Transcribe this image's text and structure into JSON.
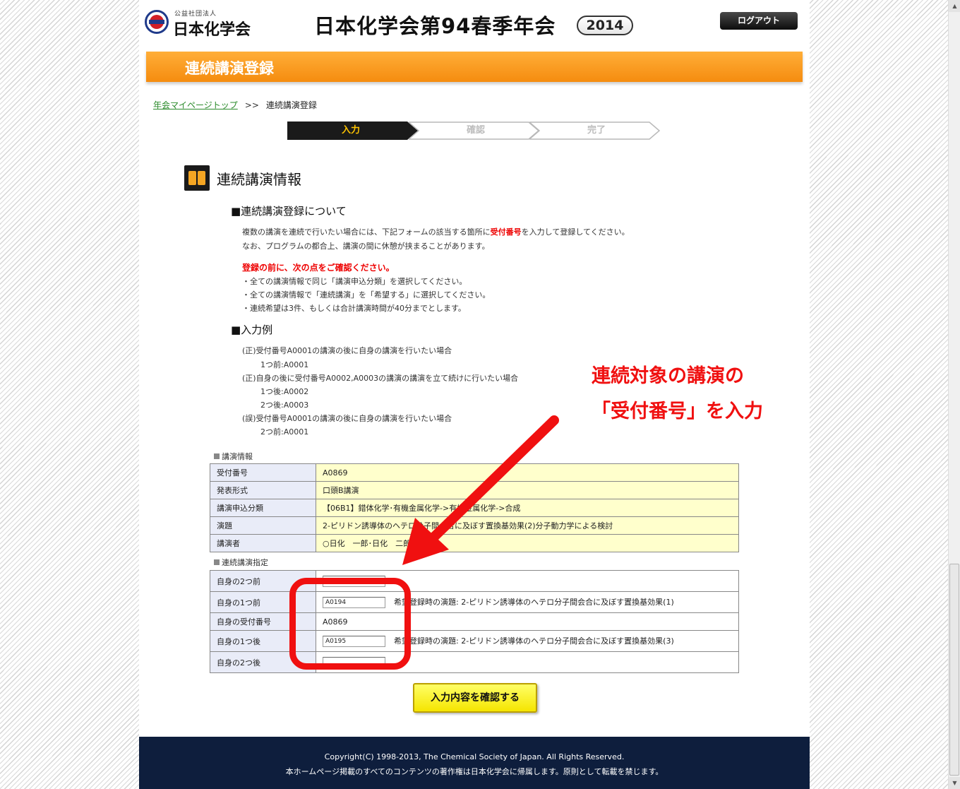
{
  "header": {
    "logo_sub": "公益社団法人",
    "logo_name": "日本化学会",
    "site_title": "日本化学会第94春季年会",
    "year": "2014",
    "logout_label": "ログアウト"
  },
  "page_title": "連続講演登録",
  "breadcrumb": {
    "home_link": "年会マイページトップ",
    "separator": ">>",
    "current": "連続講演登録"
  },
  "steps": [
    {
      "label": "入力",
      "state": "active"
    },
    {
      "label": "確認",
      "state": "inactive"
    },
    {
      "label": "完了",
      "state": "inactive"
    }
  ],
  "section_title": "連続講演情報",
  "about": {
    "heading": "■連続講演登録について",
    "line1_pre": "複数の講演を連続で行いたい場合には、下記フォームの該当する箇所に",
    "line1_red": "受付番号",
    "line1_post": "を入力して登録してください。",
    "line2": "なお、プログラムの都合上、講演の間に休憩が挟まることがあります。",
    "check_heading": "登録の前に、次の点をご確認ください。",
    "check1": "・全ての講演情報で同じ「講演申込分類」を選択してください。",
    "check2": "・全ての講演情報で「連続講演」を「希望する」に選択してください。",
    "check3": "・連続希望は3件、もしくは合計講演時間が40分までとします。"
  },
  "example": {
    "heading": "■入力例",
    "ex1": "(正)受付番号A0001の講演の後に自身の講演を行いたい場合",
    "ex1_a": "1つ前:A0001",
    "ex2": "(正)自身の後に受付番号A0002,A0003の講演の講演を立て続けに行いたい場合",
    "ex2_a": "1つ後:A0002",
    "ex2_b": "2つ後:A0003",
    "ex3": "(誤)受付番号A0001の講演の後に自身の講演を行いたい場合",
    "ex3_a": "2つ前:A0001"
  },
  "lecture_info": {
    "label": "講演情報",
    "rows": [
      {
        "key": "受付番号",
        "value": "A0869"
      },
      {
        "key": "発表形式",
        "value": "口頭B講演"
      },
      {
        "key": "講演申込分類",
        "value": "【06B1】錯体化学･有機金属化学->有機金属化学->合成"
      },
      {
        "key": "演題",
        "value": "2-ピリドン誘導体のヘテロ分子間会合に及ぼす置換基効果(2)分子動力学による検討"
      },
      {
        "key": "講演者",
        "value": "○日化　一郎･日化　二郎"
      }
    ]
  },
  "sequence": {
    "label": "連続講演指定",
    "two_before": {
      "key": "自身の2つ前",
      "value": ""
    },
    "one_before": {
      "key": "自身の1つ前",
      "value": "A0194",
      "note": "希望登録時の演題: 2-ピリドン誘導体のヘテロ分子間会合に及ぼす置換基効果(1)"
    },
    "self": {
      "key": "自身の受付番号",
      "value": "A0869"
    },
    "one_after": {
      "key": "自身の1つ後",
      "value": "A0195",
      "note": "希望登録時の演題: 2-ピリドン誘導体のヘテロ分子間会合に及ぼす置換基効果(3)"
    },
    "two_after": {
      "key": "自身の2つ後",
      "value": ""
    }
  },
  "confirm_button": "入力内容を確認する",
  "annotation": {
    "line1": "連続対象の講演の",
    "line2": "「受付番号」を入力",
    "color": "#f01010"
  },
  "footer": {
    "copyright": "Copyright(C) 1998-2013, The Chemical Society of Japan. All Rights Reserved.",
    "notice": "本ホームページ掲載のすべてのコンテンツの著作権は日本化学会に帰属します。原則として転載を禁じます。"
  },
  "colors": {
    "orange": "#f7941d",
    "footer_bg": "#0e1e3d",
    "accent_red": "#e00000",
    "table_value_bg": "#ffffcc"
  }
}
